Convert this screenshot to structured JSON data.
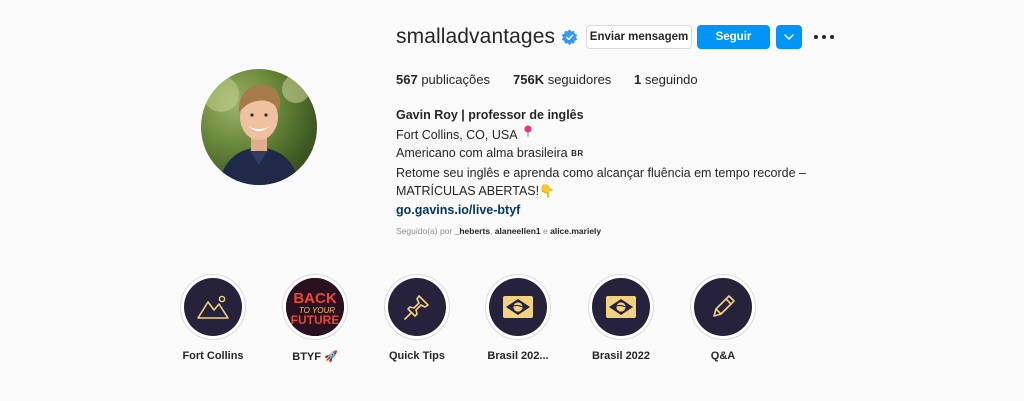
{
  "profile": {
    "username": "smalladvantages",
    "verified": true,
    "buttons": {
      "message": "Enviar mensagem",
      "follow": "Seguir"
    },
    "stats": {
      "posts_count": "567",
      "posts_label": "publicações",
      "followers_count": "756K",
      "followers_label": "seguidores",
      "following_count": "1",
      "following_label": "seguindo"
    },
    "bio": {
      "name": "Gavin Roy | professor de inglês",
      "location": "Fort Collins, CO, USA",
      "location_icon": "pin-icon",
      "line1": "Americano com alma brasileira",
      "flag": "BR",
      "line2": "Retome seu inglês e aprenda como alcançar fluência em tempo recorde –",
      "line3": "MATRÍCULAS ABERTAS!",
      "line3_emoji": "👇",
      "link": "go.gavins.io/live-btyf"
    },
    "followed_by": {
      "prefix": "Seguido(a) por",
      "user1": "_heberts",
      "user2": "alaneellen1",
      "conjunction": "e",
      "user3": "alice.mariely"
    }
  },
  "highlights": [
    {
      "label": "Fort Collins",
      "icon": "mountains-icon"
    },
    {
      "label": "BTYF 🚀",
      "icon": "back-to-your-future-cover"
    },
    {
      "label": "Quick Tips",
      "icon": "pushpin-icon"
    },
    {
      "label": "Brasil 202...",
      "icon": "brazil-flag-icon"
    },
    {
      "label": "Brasil 2022",
      "icon": "brazil-flag-icon"
    },
    {
      "label": "Q&A",
      "icon": "pencil-icon"
    }
  ],
  "highlight_cover_texts": {
    "back": "BACK",
    "to_your": "TO YOUR",
    "future": "FUTURE"
  },
  "colors": {
    "accent": "#0095f6",
    "verified": "#3897f0",
    "link": "#00376b",
    "highlight_bg": "#26223b",
    "highlight_icon": "#f2d27e"
  }
}
